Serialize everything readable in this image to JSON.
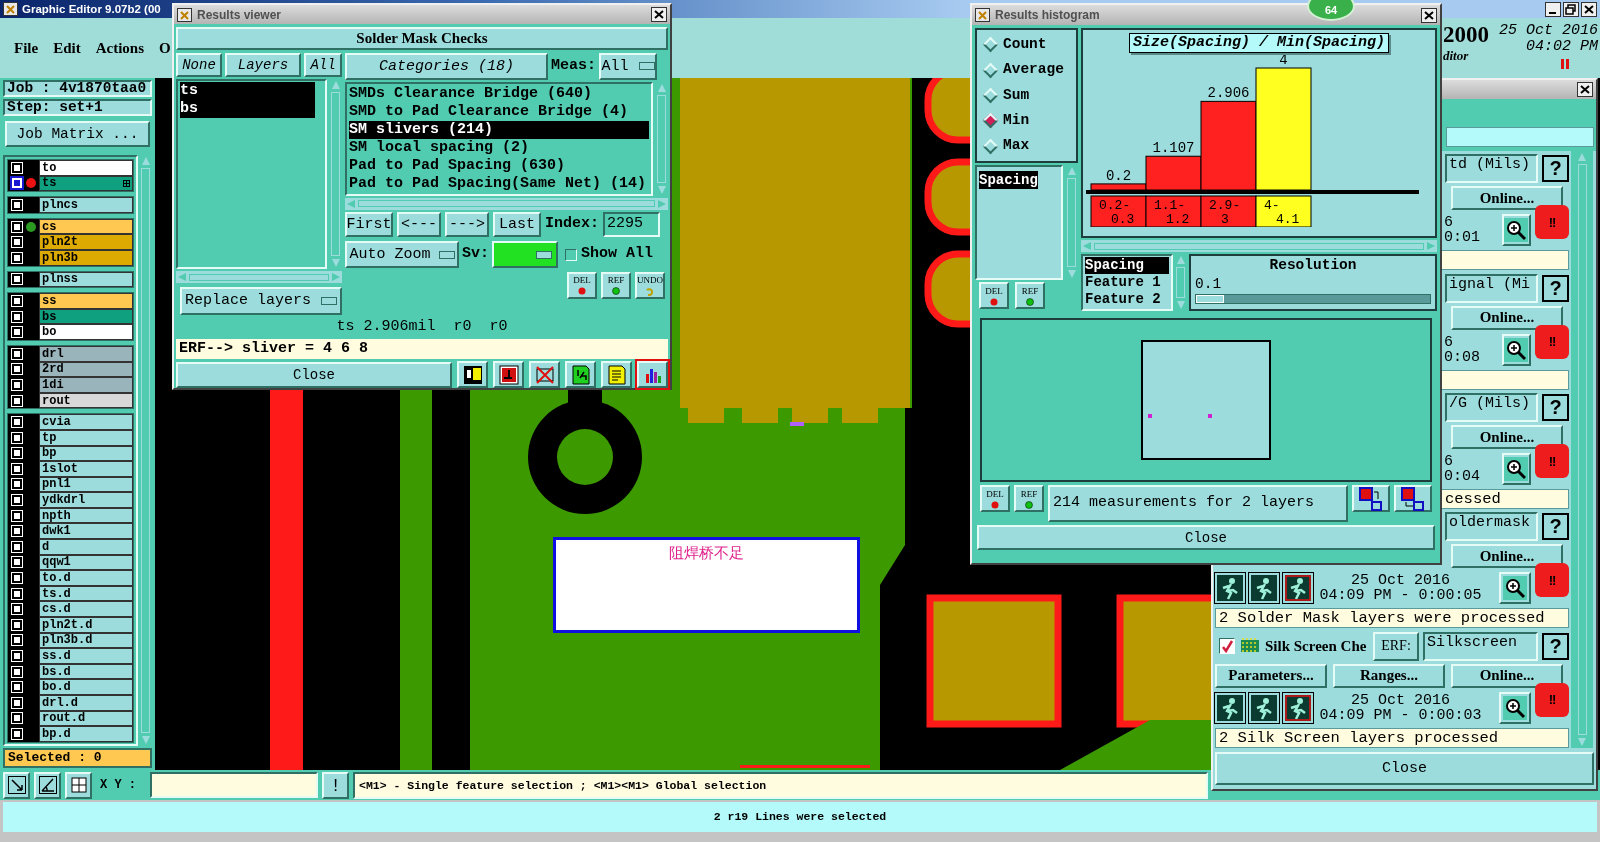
{
  "main": {
    "title": "Graphic Editor 9.07b2 (00",
    "menu": [
      "File",
      "Edit",
      "Actions",
      "O"
    ],
    "header": {
      "number": "2000",
      "date": "25 Oct 2016",
      "time": "04:02 PM",
      "subtitle": "ditor"
    },
    "job": "Job : 4v1870taa0",
    "step": "Step: set+1",
    "job_matrix": "Job Matrix ...",
    "layer_groups": [
      [
        {
          "name": "to",
          "color": "#ffffff",
          "selected": false
        },
        {
          "name": "ts",
          "color": "#0fa080",
          "selected": true,
          "marker": {
            "color": "#ee1111"
          }
        }
      ],
      [
        {
          "name": "plncs",
          "color": "#9cdcdc",
          "selected": false
        }
      ],
      [
        {
          "name": "cs",
          "color": "#ffc850",
          "selected": false,
          "marker": {
            "color": "#2a9a20"
          }
        },
        {
          "name": "pln2t",
          "color": "#dcaa00",
          "selected": false
        },
        {
          "name": "pln3b",
          "color": "#dcaa00",
          "selected": false
        }
      ],
      [
        {
          "name": "plnss",
          "color": "#9cdcdc",
          "selected": false
        }
      ],
      [
        {
          "name": "ss",
          "color": "#ffc850",
          "selected": false
        },
        {
          "name": "bs",
          "color": "#0fa080",
          "selected": false
        },
        {
          "name": "bo",
          "color": "#ffffff",
          "selected": false
        }
      ],
      [
        {
          "name": "drl",
          "color": "#9ab4bc",
          "selected": false
        },
        {
          "name": "2rd",
          "color": "#9ab4bc",
          "selected": false
        },
        {
          "name": "1di",
          "color": "#9ab4bc",
          "selected": false
        },
        {
          "name": "rout",
          "color": "#d8d8d8",
          "selected": false
        }
      ],
      [
        {
          "name": "cvia",
          "color": "#9cdcdc",
          "selected": false
        },
        {
          "name": "tp",
          "color": "#9cdcdc",
          "selected": false
        },
        {
          "name": "bp",
          "color": "#9cdcdc",
          "selected": false
        },
        {
          "name": "1slot",
          "color": "#9cdcdc",
          "selected": false
        },
        {
          "name": "pnl1",
          "color": "#9cdcdc",
          "selected": false
        },
        {
          "name": "ydkdrl",
          "color": "#9cdcdc",
          "selected": false
        },
        {
          "name": "npth",
          "color": "#9cdcdc",
          "selected": false
        },
        {
          "name": "dwk1",
          "color": "#9cdcdc",
          "selected": false
        },
        {
          "name": "d",
          "color": "#9cdcdc",
          "selected": false
        },
        {
          "name": "qqw1",
          "color": "#9cdcdc",
          "selected": false
        },
        {
          "name": "to.d",
          "color": "#9cdcdc",
          "selected": false
        },
        {
          "name": "ts.d",
          "color": "#9cdcdc",
          "selected": false
        },
        {
          "name": "cs.d",
          "color": "#9cdcdc",
          "selected": false
        },
        {
          "name": "pln2t.d",
          "color": "#9cdcdc",
          "selected": false
        },
        {
          "name": "pln3b.d",
          "color": "#9cdcdc",
          "selected": false
        },
        {
          "name": "ss.d",
          "color": "#9cdcdc",
          "selected": false
        },
        {
          "name": "bs.d",
          "color": "#9cdcdc",
          "selected": false
        },
        {
          "name": "bo.d",
          "color": "#9cdcdc",
          "selected": false
        },
        {
          "name": "drl.d",
          "color": "#9cdcdc",
          "selected": false
        },
        {
          "name": "rout.d",
          "color": "#9cdcdc",
          "selected": false
        },
        {
          "name": "bp.d",
          "color": "#9cdcdc",
          "selected": false
        }
      ]
    ],
    "selected_count": "Selected : 0",
    "annotation": "阻焊桥不足",
    "xy_label": "X Y :",
    "alert_button": "!",
    "hint": "<M1> - Single feature selection ; <M1><M1> Global selection",
    "status": "2 r19 Lines were selected"
  },
  "results_viewer": {
    "title": "Results viewer",
    "heading": "Solder Mask Checks",
    "layer_buttons": [
      "None",
      "Layers",
      "All"
    ],
    "layers": [
      {
        "name": "ts",
        "selected": true
      },
      {
        "name": "bs",
        "selected": true
      }
    ],
    "replace": "Replace layers",
    "categories_button": "Categories (18)",
    "meas_label": "Meas:",
    "meas_value": "All",
    "categories": [
      {
        "label": "SMDs Clearance Bridge (640)",
        "selected": false
      },
      {
        "label": "SMD to Pad Clearance Bridge (4)",
        "selected": false
      },
      {
        "label": "SM slivers (214)",
        "selected": true
      },
      {
        "label": "SM local spacing (2)",
        "selected": false
      },
      {
        "label": "Pad to Pad Spacing (630)",
        "selected": false
      },
      {
        "label": "Pad to Pad Spacing(Same Net) (14)",
        "selected": false
      }
    ],
    "nav": [
      "First",
      "<---",
      "--->",
      "Last"
    ],
    "index_label": "Index:",
    "index_value": "2295",
    "auto_zoom": "Auto Zoom",
    "sv_label": "Sv:",
    "show_all": {
      "label": "Show All",
      "checked": false
    },
    "action_buttons": [
      "DEL",
      "REF",
      "UNDO"
    ],
    "measurement": "ts 2.906mil  r0  r0",
    "erf": "ERF--> sliver = 4 6 8",
    "close": "Close"
  },
  "histogram": {
    "title": "Results histogram",
    "badge": "64",
    "modes": [
      {
        "label": "Count",
        "selected": false
      },
      {
        "label": "Average",
        "selected": false
      },
      {
        "label": "Sum",
        "selected": false
      },
      {
        "label": "Min",
        "selected": true
      },
      {
        "label": "Max",
        "selected": false
      }
    ],
    "fields": [
      {
        "label": "Spacing",
        "selected": true
      }
    ],
    "buttons": [
      "DEL",
      "REF"
    ],
    "chart_data": {
      "type": "bar",
      "title": "Size(Spacing) / Min(Spacing)",
      "categories": [
        "0.2-0.3",
        "1.1-1.2",
        "2.9-3",
        "4-4.1"
      ],
      "series": [
        {
          "color": "#ff2020",
          "values": [
            0.2,
            1.107,
            2.906,
            null
          ]
        },
        {
          "color": "#ffff20",
          "values": [
            null,
            null,
            null,
            4
          ]
        }
      ],
      "stacked": true,
      "data_labels": true
    },
    "features": [
      {
        "label": "Spacing",
        "selected": true
      },
      {
        "label": "Feature 1",
        "selected": false
      },
      {
        "label": "Feature 2",
        "selected": false
      }
    ],
    "resolution": {
      "label": "Resolution",
      "value": "0.1",
      "level": 0
    },
    "summary_buttons": [
      "DEL",
      "REF"
    ],
    "summary": "214 measurements for 2 layers",
    "close": "Close"
  },
  "checks_window": {
    "checks": [
      {
        "kind": "cut",
        "name": "td (Mils)",
        "help": "?",
        "online": "Online...",
        "date": "6",
        "time": "0:01",
        "alert": "!!"
      },
      {
        "kind": "cut",
        "name": "ignal (Mi",
        "help": "?",
        "online": "Online...",
        "date": "6",
        "time": "0:08",
        "alert": "!!"
      },
      {
        "kind": "cut",
        "name": "/G (Mils)",
        "help": "?",
        "online": "Online...",
        "date": "6",
        "time": "0:04",
        "alert": "!!",
        "message": "cessed"
      },
      {
        "kind": "full",
        "name": "oldermask",
        "help": "?",
        "online": "Online...",
        "date": "25 Oct 2016",
        "time": "04:09 PM - 0:00:05",
        "alert": "!!",
        "message": "2 Solder Mask layers were processed"
      },
      {
        "kind": "full",
        "checked": true,
        "title": "Silk Screen Che",
        "erf": "ERF:",
        "name": "Silkscreen",
        "help": "?",
        "parameters": "Parameters...",
        "ranges": "Ranges...",
        "online": "Online...",
        "date": "25 Oct 2016",
        "time": "04:09 PM - 0:00:03",
        "alert": "!!",
        "message": "2 Silk Screen layers processed"
      }
    ],
    "close": "Close"
  }
}
